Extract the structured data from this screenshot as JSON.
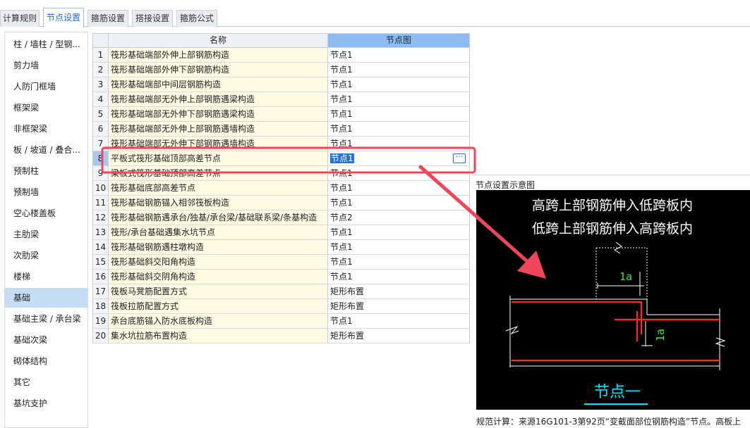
{
  "tabs": [
    {
      "label": "计算规则",
      "active": false
    },
    {
      "label": "节点设置",
      "active": true
    },
    {
      "label": "箍筋设置",
      "active": false
    },
    {
      "label": "搭接设置",
      "active": false
    },
    {
      "label": "箍筋公式",
      "active": false
    }
  ],
  "sidebar": {
    "selected": "基础",
    "items": [
      {
        "label": "柱 / 墙柱 / 型钢..."
      },
      {
        "label": "剪力墙"
      },
      {
        "label": "人防门框墙"
      },
      {
        "label": "框架梁"
      },
      {
        "label": "非框架梁"
      },
      {
        "label": "板 / 坡道 / 叠合..."
      },
      {
        "label": "预制柱"
      },
      {
        "label": "预制墙"
      },
      {
        "label": "空心楼盖板"
      },
      {
        "label": "主肋梁"
      },
      {
        "label": "次肋梁"
      },
      {
        "label": "楼梯"
      },
      {
        "label": "基础"
      },
      {
        "label": "基础主梁 / 承台梁"
      },
      {
        "label": "基础次梁"
      },
      {
        "label": "砌体结构"
      },
      {
        "label": "其它"
      },
      {
        "label": "基坑支护"
      }
    ]
  },
  "table": {
    "headers": {
      "name": "名称",
      "node": "节点图"
    },
    "selected_row": 8,
    "rows": [
      {
        "num": "1",
        "name": "筏形基础端部外伸上部钢筋构造",
        "node": "节点1"
      },
      {
        "num": "2",
        "name": "筏形基础端部外伸下部钢筋构造",
        "node": "节点1"
      },
      {
        "num": "3",
        "name": "筏形基础端部中间层钢筋构造",
        "node": "节点1"
      },
      {
        "num": "4",
        "name": "筏形基础端部无外伸上部钢筋遇梁构造",
        "node": "节点1"
      },
      {
        "num": "5",
        "name": "筏形基础端部无外伸下部钢筋遇梁构造",
        "node": "节点1"
      },
      {
        "num": "6",
        "name": "筏形基础端部无外伸上部钢筋遇墙构造",
        "node": "节点1"
      },
      {
        "num": "7",
        "name": "筏形基础端部无外伸下部钢筋遇墙构造",
        "node": "节点1"
      },
      {
        "num": "8",
        "name": "平板式筏形基础顶部高差节点",
        "node": "节点1"
      },
      {
        "num": "9",
        "name": "梁板式筏形基础顶部高差节点",
        "node": "节点1"
      },
      {
        "num": "10",
        "name": "筏形基础底部高差节点",
        "node": "节点1"
      },
      {
        "num": "11",
        "name": "筏形基础钢筋锚入相邻筏板构造",
        "node": "节点1"
      },
      {
        "num": "12",
        "name": "筏形基础钢筋遇承台/独基/承台梁/基础联系梁/条基构造",
        "node": "节点2"
      },
      {
        "num": "13",
        "name": "筏形/承台基础遇集水坑节点",
        "node": "节点1"
      },
      {
        "num": "14",
        "name": "筏形基础钢筋遇柱墩构造",
        "node": "节点1"
      },
      {
        "num": "15",
        "name": "筏形基础斜交阳角构造",
        "node": "节点1"
      },
      {
        "num": "16",
        "name": "筏形基础斜交阴角构造",
        "node": "节点1"
      },
      {
        "num": "17",
        "name": "筏板马凳筋配置方式",
        "node": "矩形布置"
      },
      {
        "num": "18",
        "name": "筏板拉筋配置方式",
        "node": "矩形布置"
      },
      {
        "num": "19",
        "name": "承台底筋锚入防水底板构造",
        "node": "节点1"
      },
      {
        "num": "20",
        "name": "集水坑拉筋布置构造",
        "node": "矩形布置"
      }
    ]
  },
  "diagram": {
    "title": "节点设置示意图",
    "line1": "高跨上部钢筋伸入低跨板内",
    "line2": "低跨上部钢筋伸入高跨板内",
    "dim_horizontal": "1a",
    "dim_vertical": "1a",
    "node_label": "节点一",
    "footnote": "规范计算：来源16G101-3第92页“变截面部位钢筋构造”节点。高板上",
    "colors": {
      "background": "#000000",
      "rebar": "#ff2a2a",
      "dimension": "#39e639",
      "label": "#00e5ff"
    }
  },
  "annotation": {
    "color": "#f0465a"
  }
}
